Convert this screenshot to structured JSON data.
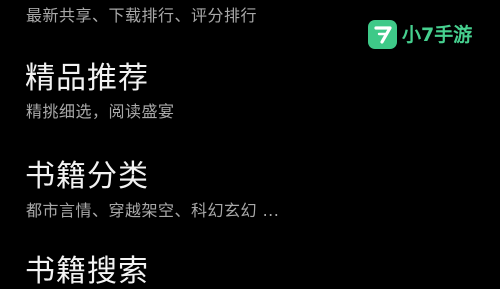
{
  "menu": {
    "items": [
      {
        "title": "",
        "subtitle": "最新共享、下载排行、评分排行"
      },
      {
        "title": "精品推荐",
        "subtitle": "精挑细选，阅读盛宴"
      },
      {
        "title": "书籍分类",
        "subtitle": "都市言情、穿越架空、科幻玄幻 ..."
      },
      {
        "title": "书籍搜索",
        "subtitle": ""
      }
    ]
  },
  "watermark": {
    "icon": "number-7-logo-icon",
    "text": "小7手游",
    "color": "#3ec988"
  },
  "colors": {
    "background": "#000000",
    "title": "#f2f2f2",
    "subtitle": "#a8a8a8"
  }
}
